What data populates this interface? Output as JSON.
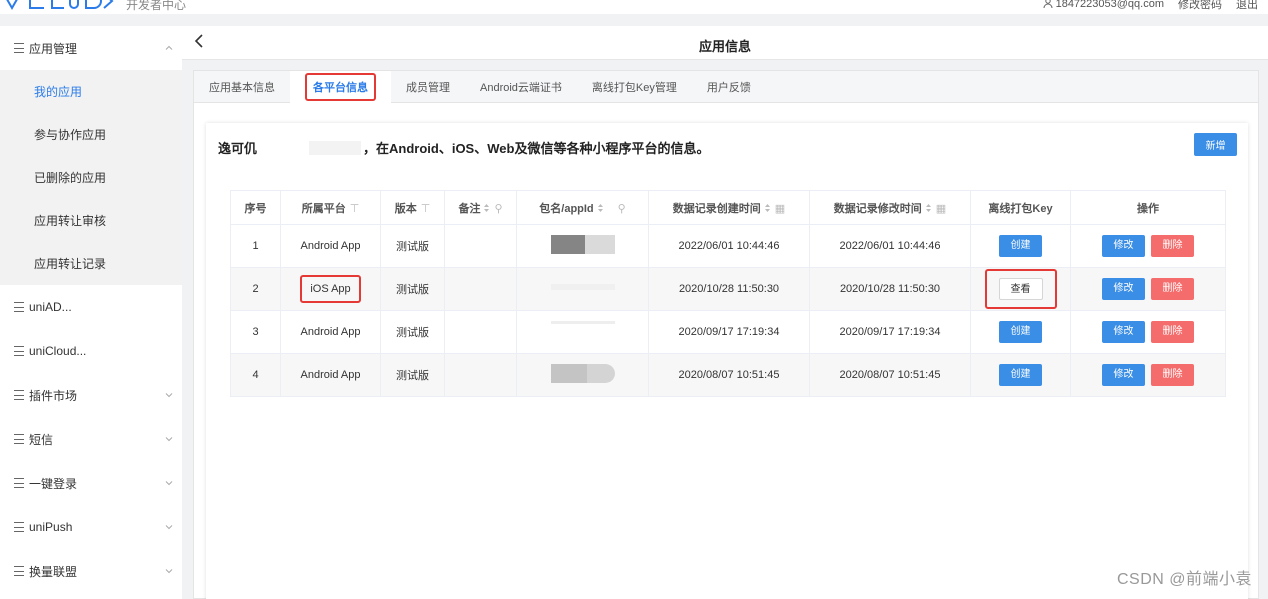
{
  "app": {
    "subtitle": "开发者中心",
    "user_email": "1847223053@qq.com",
    "change_password": "修改密码",
    "logout": "退出"
  },
  "sidebar": {
    "group_app": "应用管理",
    "sub_items": [
      "我的应用",
      "参与协作应用",
      "已删除的应用",
      "应用转让审核",
      "应用转让记录"
    ],
    "groups": [
      "uniAD...",
      "uniCloud...",
      "插件市场",
      "短信",
      "一键登录",
      "uniPush",
      "换量联盟"
    ]
  },
  "header": {
    "title": "应用信息"
  },
  "tabs": [
    "应用基本信息",
    "各平台信息",
    "成员管理",
    "Android云端证书",
    "离线打包Key管理",
    "用户反馈"
  ],
  "intro": {
    "app_name": "逸可仉",
    "desc": "，在Android、iOS、Web及微信等各种小程序平台的信息。",
    "add_label": "新增"
  },
  "table": {
    "headers": [
      "序号",
      "所属平台",
      "版本",
      "备注",
      "包名/appId",
      "数据记录创建时间",
      "数据记录修改时间",
      "离线打包Key",
      "操作"
    ],
    "rows": [
      {
        "no": "1",
        "platform": "Android App",
        "version": "测试版",
        "created": "2022/06/01 10:44:46",
        "modified": "2022/06/01 10:44:46",
        "key_action": "创建"
      },
      {
        "no": "2",
        "platform": "iOS App",
        "version": "测试版",
        "created": "2020/10/28 11:50:30",
        "modified": "2020/10/28 11:50:30",
        "key_action": "查看"
      },
      {
        "no": "3",
        "platform": "Android App",
        "version": "测试版",
        "created": "2020/09/17 17:19:34",
        "modified": "2020/09/17 17:19:34",
        "key_action": "创建"
      },
      {
        "no": "4",
        "platform": "Android App",
        "version": "测试版",
        "created": "2020/08/07 10:51:45",
        "modified": "2020/08/07 10:51:45",
        "key_action": "创建"
      }
    ],
    "edit_label": "修改",
    "delete_label": "删除"
  },
  "watermark": "CSDN @前端小袁",
  "colors": {
    "primary": "#3a8ee6",
    "danger": "#f56c6c",
    "highlight": "#e53935",
    "active_text": "#2b7ce9"
  }
}
